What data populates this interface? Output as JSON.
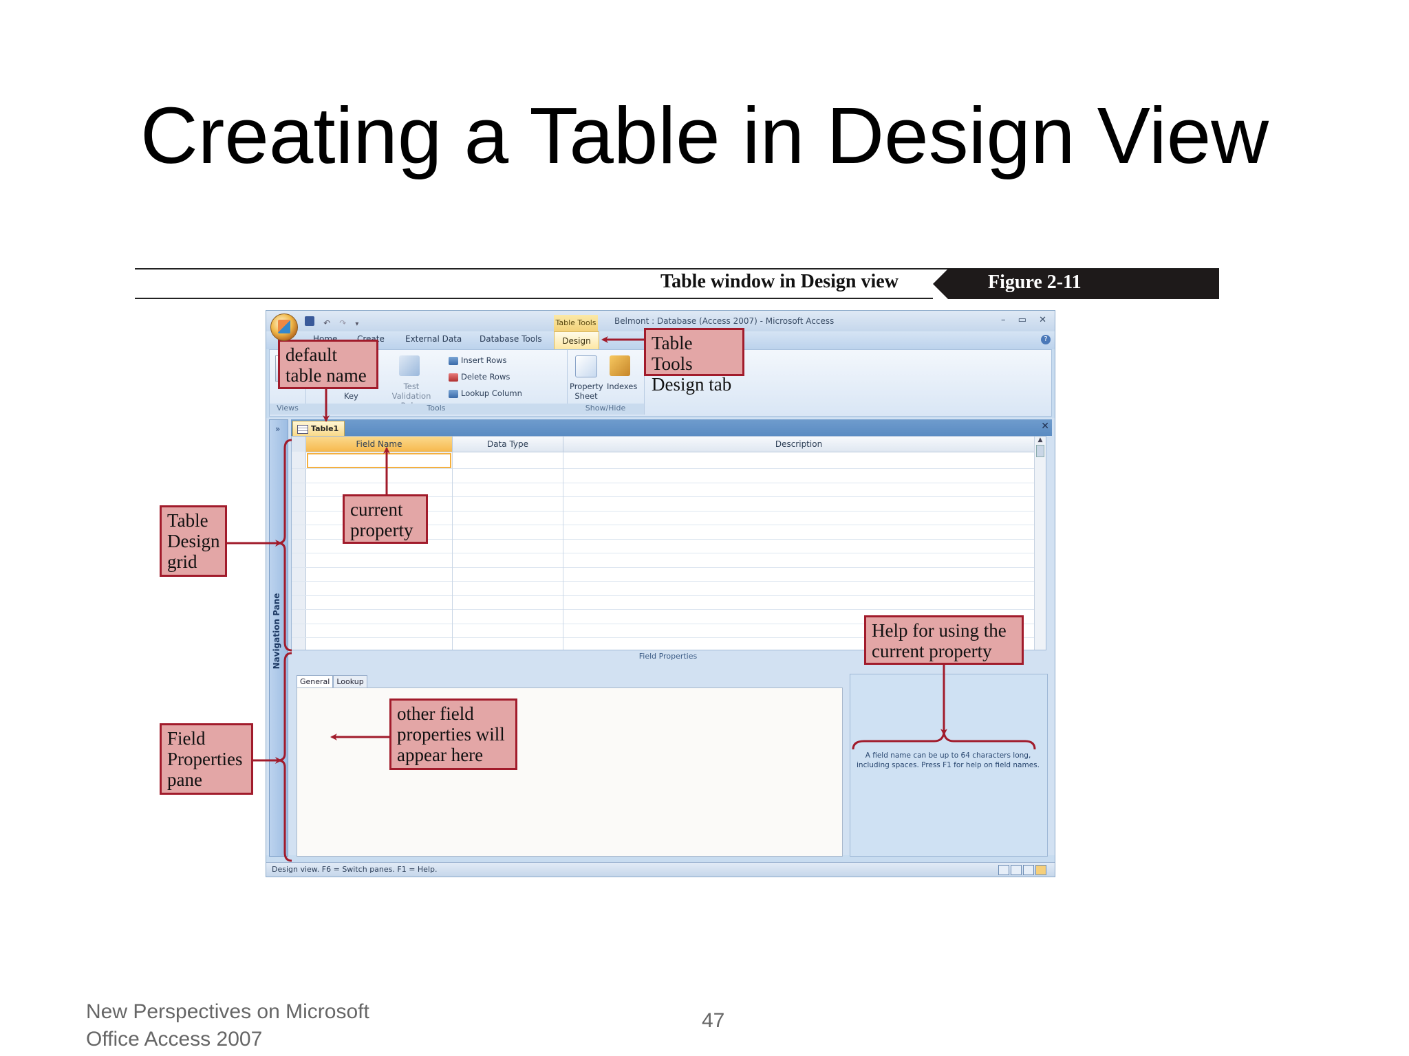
{
  "slide": {
    "title": "Creating a Table in Design View",
    "footer": "New Perspectives on Microsoft Office Access 2007",
    "footer_line1": "New Perspectives on Microsoft",
    "footer_line2": "Office Access 2007",
    "page_number": "47"
  },
  "figure": {
    "caption": "Table window in Design view",
    "label": "Figure  2-11"
  },
  "window": {
    "title": "Belmont : Database (Access 2007) - Microsoft Access",
    "contextual_group": "Table Tools",
    "ribbon_tabs": [
      "Home",
      "Create",
      "External Data",
      "Database Tools",
      "Design"
    ],
    "active_tab": "Design",
    "ribbon": {
      "views_label": "Views",
      "tools_label": "Tools",
      "showhide_label": "Show/Hide",
      "key_label": "Key",
      "test_validation": "Test Validation",
      "rules": "Rules",
      "insert_rows": "Insert Rows",
      "delete_rows": "Delete Rows",
      "lookup_column": "Lookup Column",
      "property": "Property",
      "sheet": "Sheet",
      "indexes": "Indexes"
    },
    "nav_pane_label": "Navigation Pane",
    "document_tab": "Table1",
    "grid_headers": [
      "Field Name",
      "Data Type",
      "Description"
    ],
    "field_properties_label": "Field Properties",
    "property_tabs": [
      "General",
      "Lookup"
    ],
    "help_text": "A field name can be up to 64 characters long, including spaces. Press F1 for help on field names.",
    "status_text": "Design view.  F6 = Switch panes.  F1 = Help."
  },
  "callouts": {
    "default_table_name_1": "default",
    "default_table_name_2": "table name",
    "table_tools_1": "Table Tools",
    "table_tools_2": "Design tab",
    "current_property_1": "current",
    "current_property_2": "property",
    "table_design_grid_1": "Table",
    "table_design_grid_2": "Design",
    "table_design_grid_3": "grid",
    "help_1": "Help for using the",
    "help_2": "current property",
    "other_props_1": "other field",
    "other_props_2": "properties will",
    "other_props_3": "appear here",
    "field_props_1": "Field",
    "field_props_2": "Properties",
    "field_props_3": "pane"
  },
  "colors": {
    "callout_fill": "#e3a6a6",
    "callout_border": "#a11b2b",
    "active_tab": "#f8d886"
  }
}
